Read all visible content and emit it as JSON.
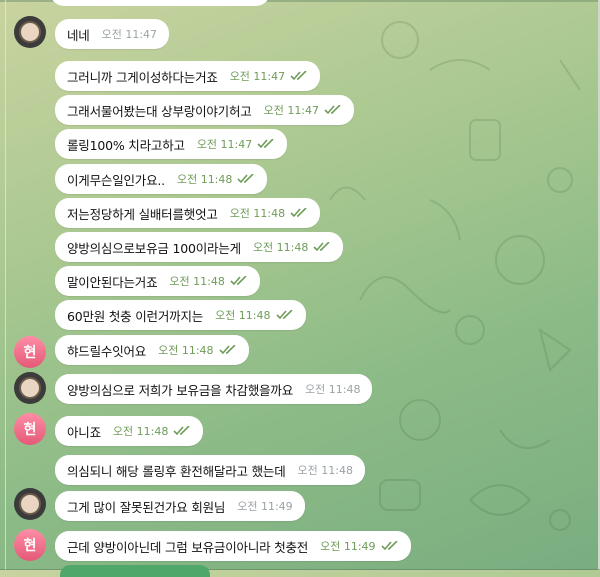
{
  "colors": {
    "time_outgoing": "#6f9c58",
    "time_incoming": "#9aa3a6",
    "avatar_letter_bg": "#e35a78",
    "bubble_bg": "#ffffff"
  },
  "avatars": {
    "letter": "현"
  },
  "messages": [
    {
      "text": "네네",
      "time": "오전 11:47"
    },
    {
      "text": "그러니까 그게이성하다는거죠",
      "time": "오전 11:47"
    },
    {
      "text": "그래서물어봤는대 상부랑이야기허고",
      "time": "오전 11:47"
    },
    {
      "text": "롤링100% 치라고하고",
      "time": "오전 11:47"
    },
    {
      "text": "이게무슨일인가요..",
      "time": "오전 11:48"
    },
    {
      "text": "저는정당하게 실배터를햇엇고",
      "time": "오전 11:48"
    },
    {
      "text": "양방의심으로보유금 100이라는게",
      "time": "오전 11:48"
    },
    {
      "text": "말이안된다는거죠",
      "time": "오전 11:48"
    },
    {
      "text": "60만원 첫충 이런거까지는",
      "time": "오전 11:48"
    },
    {
      "text": "햐드릴수잇어요",
      "time": "오전 11:48"
    },
    {
      "text": "양방의심으로 저희가 보유금을 차감했을까요",
      "time": "오전 11:48"
    },
    {
      "text": "아니죠",
      "time": "오전 11:48"
    },
    {
      "text": "의심되니 해당 롤링후 환전해달라고 했는데",
      "time": "오전 11:48"
    },
    {
      "text": "그게 많이 잘못된건가요 회원님",
      "time": "오전 11:49"
    },
    {
      "text": "근데 양방이아닌데 그럼 보유금이아니라 첫충전",
      "time": "오전 11:49"
    }
  ]
}
